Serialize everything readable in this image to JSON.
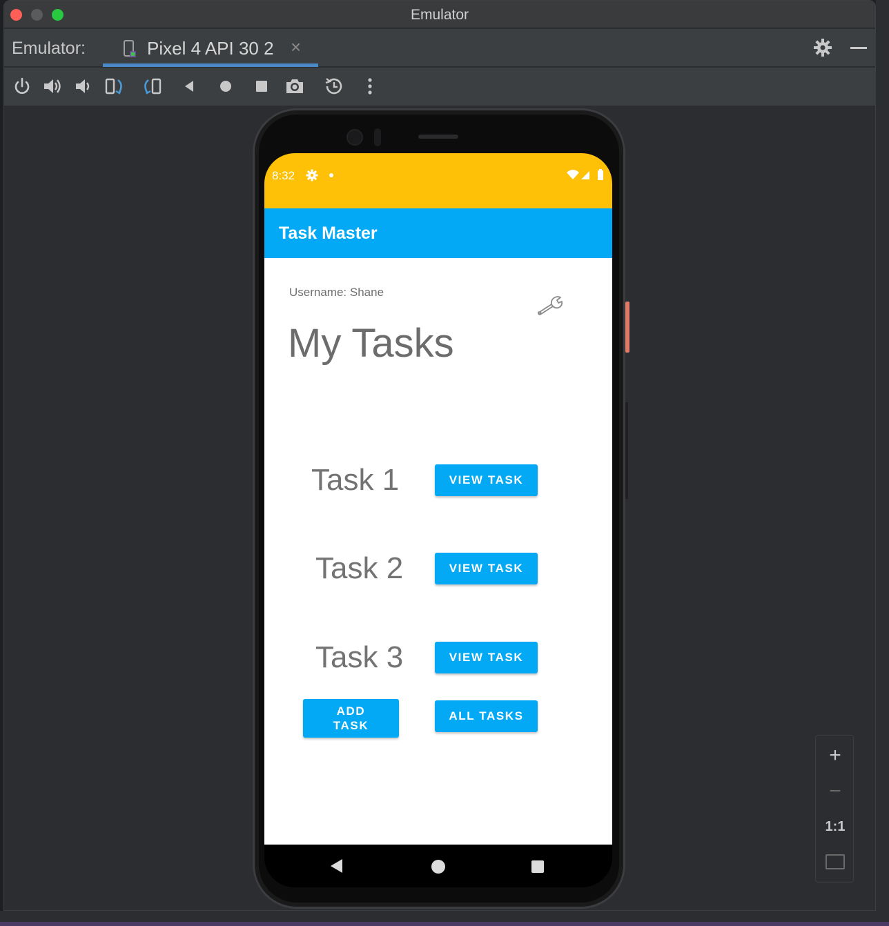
{
  "window": {
    "title": "Emulator"
  },
  "tabbar": {
    "label": "Emulator:",
    "device_tab": "Pixel 4 API 30 2",
    "close_glyph": "×"
  },
  "toolbar": {
    "icons": [
      "power-icon",
      "volume-up-icon",
      "volume-down-icon",
      "rotate-left-icon",
      "rotate-right-icon",
      "back-icon",
      "home-icon",
      "overview-icon",
      "camera-icon",
      "snapshot-icon",
      "more-icon"
    ]
  },
  "phone": {
    "status": {
      "time": "8:32"
    },
    "app": {
      "title": "Task Master",
      "username": "Username: Shane",
      "heading": "My Tasks",
      "tasks": [
        {
          "label": "Task 1",
          "button": "VIEW TASK"
        },
        {
          "label": "Task 2",
          "button": "VIEW TASK"
        },
        {
          "label": "Task 3",
          "button": "VIEW TASK"
        }
      ],
      "add_task": "ADD\nTASK",
      "all_tasks": "ALL TASKS"
    }
  },
  "zoom": {
    "plus": "+",
    "minus": "−",
    "one_to_one": "1:1"
  },
  "colors": {
    "status_bar": "#ffc107",
    "app_bar": "#03a9f4",
    "button": "#03a9f4",
    "tab_underline": "#4a88c7"
  }
}
